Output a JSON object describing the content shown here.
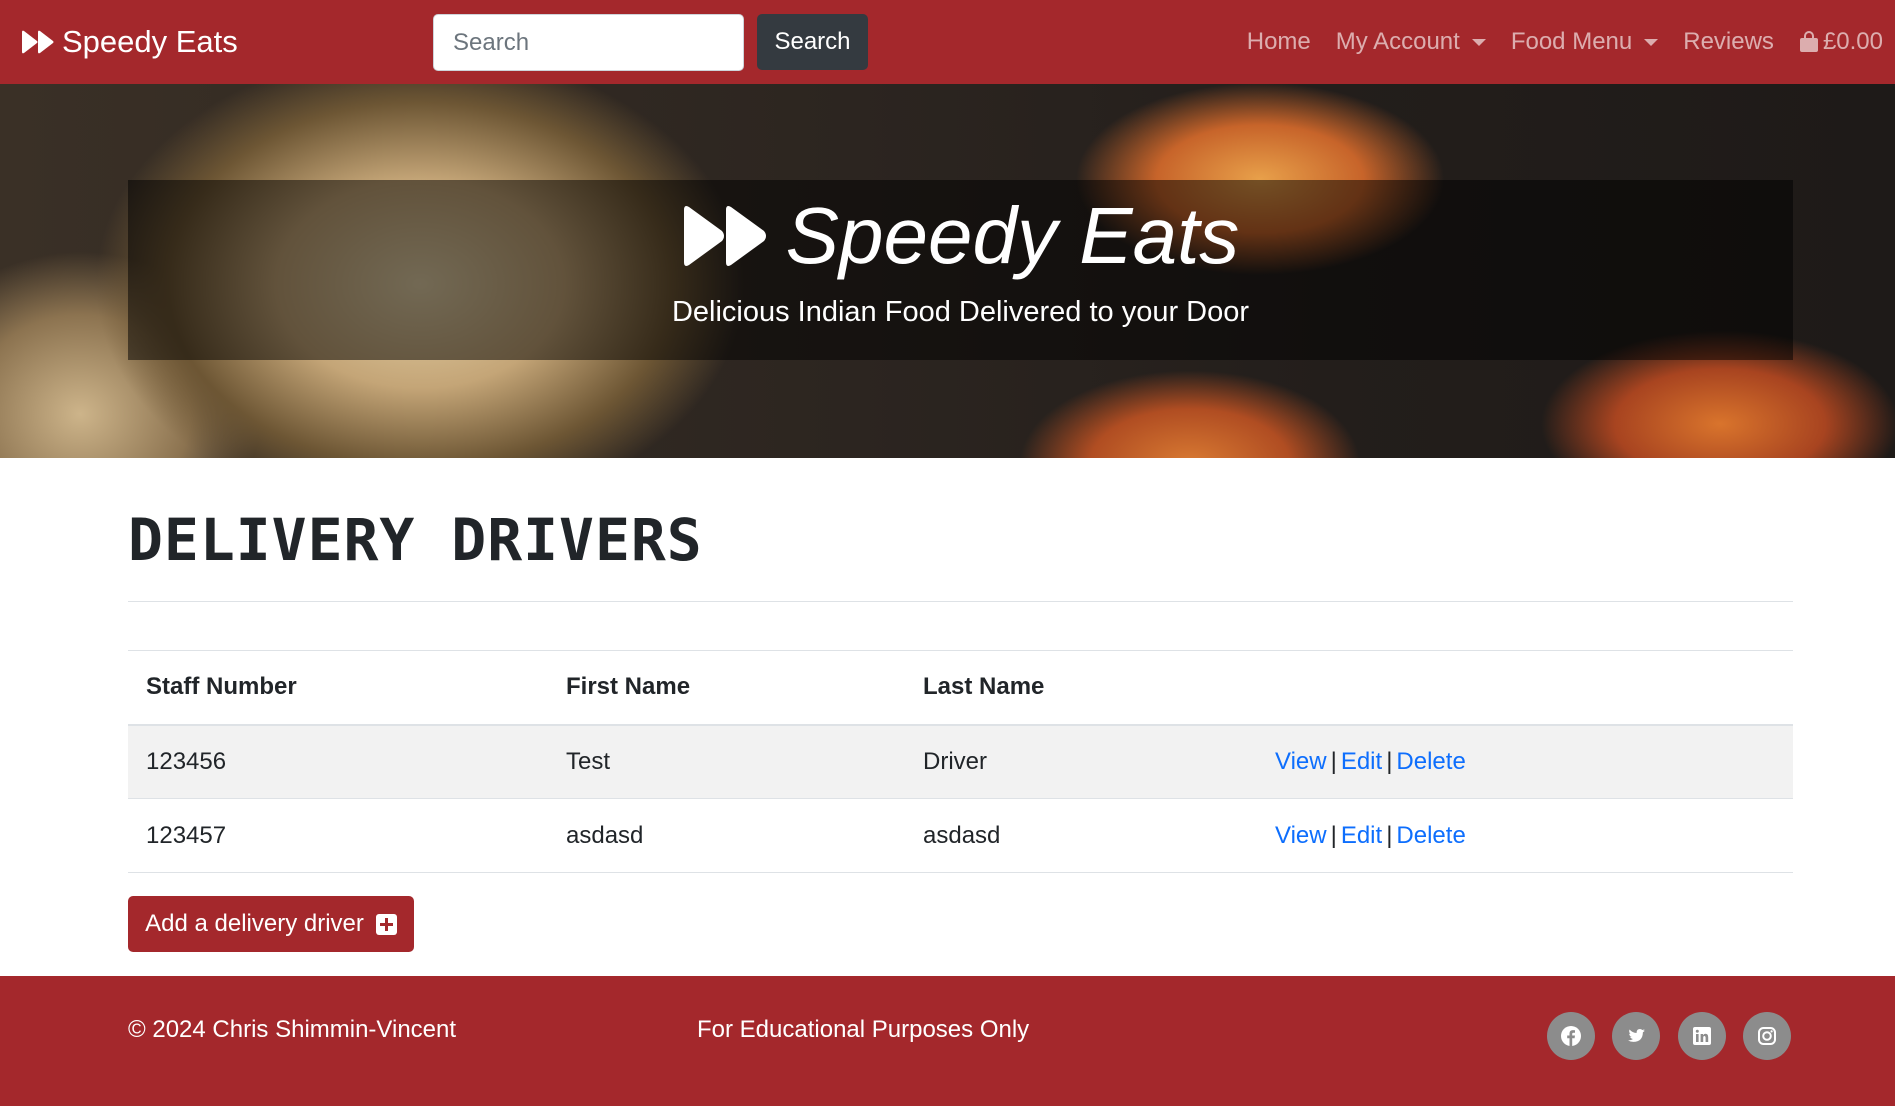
{
  "brand": {
    "name": "Speedy Eats"
  },
  "search": {
    "placeholder": "Search",
    "button_label": "Search"
  },
  "nav": {
    "home": "Home",
    "my_account": "My Account",
    "food_menu": "Food Menu",
    "reviews": "Reviews",
    "basket_total": "£0.00"
  },
  "hero": {
    "title": "Speedy Eats",
    "subtitle": "Delicious Indian Food Delivered to your Door"
  },
  "page": {
    "title": "DELIVERY DRIVERS"
  },
  "table": {
    "headers": [
      "Staff Number",
      "First Name",
      "Last Name",
      ""
    ],
    "rows": [
      {
        "staff_number": "123456",
        "first_name": "Test",
        "last_name": "Driver"
      },
      {
        "staff_number": "123457",
        "first_name": "asdasd",
        "last_name": "asdasd"
      }
    ],
    "actions": {
      "view": "View",
      "edit": "Edit",
      "delete": "Delete",
      "separator": "|"
    }
  },
  "add_button": {
    "label": "Add a delivery driver"
  },
  "footer": {
    "copyright": "© 2024 Chris Shimmin-Vincent",
    "notice": "For Educational Purposes Only",
    "social": [
      "facebook-icon",
      "twitter-icon",
      "linkedin-icon",
      "instagram-icon"
    ]
  },
  "colors": {
    "brand": "#a4282c",
    "search_button": "#343a40",
    "link": "#0d6efd",
    "social_bg": "#8c8c8c"
  }
}
